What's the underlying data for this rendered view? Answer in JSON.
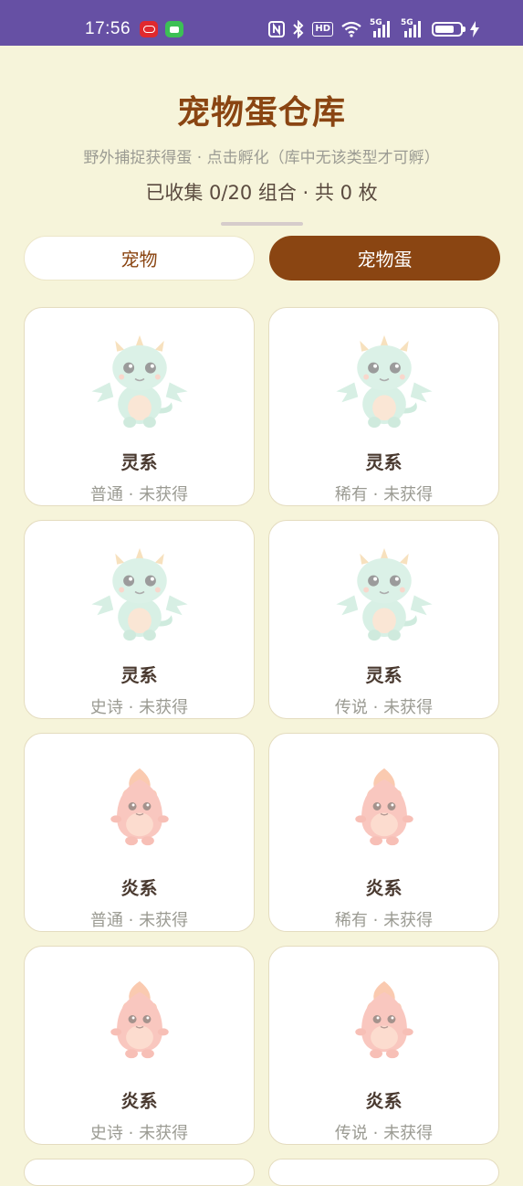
{
  "status_bar": {
    "time": "17:56",
    "icons": [
      "app-red-icon",
      "message-icon",
      "nfc-icon",
      "bluetooth-icon",
      "hd-icon",
      "wifi-icon",
      "signal-5g-icon",
      "signal-5g-icon",
      "battery-icon",
      "charging-icon"
    ],
    "network_labels": [
      "5G",
      "5G"
    ],
    "hd_label": "HD"
  },
  "header": {
    "title": "宠物蛋仓库",
    "subtitle": "野外捕捉获得蛋 · 点击孵化（库中无该类型才可孵）",
    "counts": "已收集 0/20 组合 · 共 0 枚"
  },
  "tabs": [
    {
      "label": "宠物",
      "active": false
    },
    {
      "label": "宠物蛋",
      "active": true
    }
  ],
  "eggs": [
    {
      "type": "dragon",
      "name": "灵系",
      "status": "普通 · 未获得"
    },
    {
      "type": "dragon",
      "name": "灵系",
      "status": "稀有 · 未获得"
    },
    {
      "type": "dragon",
      "name": "灵系",
      "status": "史诗 · 未获得"
    },
    {
      "type": "dragon",
      "name": "灵系",
      "status": "传说 · 未获得"
    },
    {
      "type": "flame",
      "name": "炎系",
      "status": "普通 · 未获得"
    },
    {
      "type": "flame",
      "name": "炎系",
      "status": "稀有 · 未获得"
    },
    {
      "type": "flame",
      "name": "炎系",
      "status": "史诗 · 未获得"
    },
    {
      "type": "flame",
      "name": "炎系",
      "status": "传说 · 未获得"
    }
  ],
  "colors": {
    "status_bar": "#6650a4",
    "background": "#f6f4da",
    "accent": "#8a4512",
    "card_border": "#e4dcbf"
  }
}
